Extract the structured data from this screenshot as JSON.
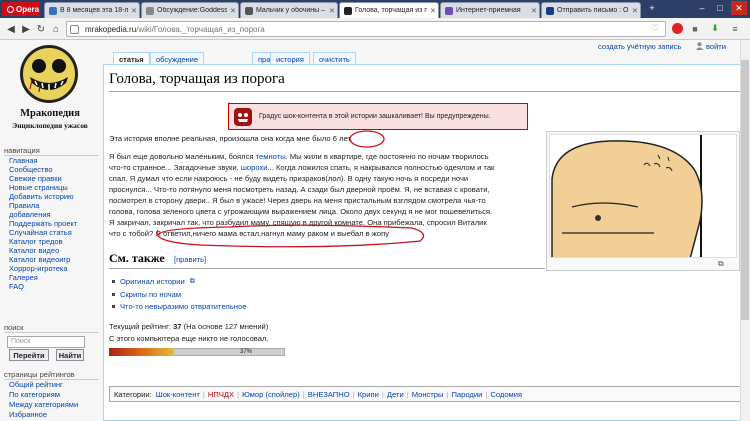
{
  "browser": {
    "opera_label": "Opera",
    "tabs": [
      {
        "label": "В 8 месяцев эта 18-летн...",
        "fav": "#3b6fbe"
      },
      {
        "label": "Обсуждение:Goddess o...",
        "fav": "#888888"
      },
      {
        "label": "Мальчик у обочины – ...",
        "fav": "#555555"
      },
      {
        "label": "Голова, торчащая из п...",
        "fav": "#222222"
      },
      {
        "label": "Интернет-приемная",
        "fav": "#6a4fb5"
      },
      {
        "label": "Отправить письмо : О...",
        "fav": "#1a3a8a"
      }
    ],
    "url_host": "mrakopedia.ru",
    "url_path": "/wiki/Голова,_торчащая_из_порога"
  },
  "personal": {
    "create_account": "создать учётную запись",
    "login": "войти"
  },
  "logo": {
    "title": "Мракопедия",
    "subtitle": "Энциклопедия ужасов"
  },
  "page_tabs": [
    "статья",
    "обсуждение",
    "править",
    "история",
    "очистить"
  ],
  "article": {
    "title": "Голова, торчащая из порога",
    "warning": "Градус шок-контента в этой истории зашкаливает! Вы предупреждены.",
    "lines": [
      [
        "Эта история вполне реальная, произошла она когда мне было 6 лет."
      ],
      [
        "Я был еще довольно маленьким, боялся ",
        "темноты",
        ". Мы жили в квартире, где постоянно по ночам творилось"
      ],
      [
        "что-то странное... Загадочные звуки, ",
        "шорохи",
        "... Когда ложился спать, я накрывался полностью одеялом и так"
      ],
      [
        "спал. Я думал что если накроюсь - не буду видеть призраков(лол). В одну такую ночь я посреди ночи"
      ],
      [
        "проснулся... Что-то потянуло меня посмотреть назад. А сзади был дверной проём. Я, не вставая с кровати,"
      ],
      [
        "посмотрел в сторону двери.. Я был в ужасе! Через дверь на меня пристальным взглядом смотрела чья-то"
      ],
      [
        "голова, голова зеленого цвета с угрожающим выражением лица. Около двух секунд я не мог пошевелиться."
      ],
      [
        "Я закричал, закричал так, что разбудил маму, спящую в другой комнате. Она прибежала, спросил Виталик"
      ],
      [
        "что с тобой? Я ответил,ничего мама встал,нагнул маму раком и выебал в жопу"
      ]
    ],
    "see_also_title": "См. также",
    "edit_link": "[править]",
    "see_also": [
      "Оригинал истории",
      "Скрипы по ночам",
      "Что-то невыразимо отвратительное"
    ],
    "rating_prefix": "Текущий рейтинг: ",
    "rating_value": "37",
    "rating_suffix": " (На основе 127 мнений)",
    "vote_status": "С этого компьютера еще никто не голосовал.",
    "rating_percent": 37,
    "rating_bar_label": "37%"
  },
  "categories": {
    "label": "Категории:",
    "items": [
      "Шок-контент",
      "НПЧДХ",
      "Юмор (спойлер)",
      "ВНЕЗАПНО",
      "Крипи",
      "Дети",
      "Монстры",
      "Пародии",
      "Содомия"
    ]
  },
  "sidebar": {
    "nav_title": "навигация",
    "nav": [
      "Главная",
      "Сообщество",
      "Свежие правки",
      "Новые страницы",
      "Добавить историю",
      "Правила",
      "добавления",
      "Поддержать проект",
      "Случайная статья",
      "Каталог тредов",
      "Каталог видео",
      "Каталог видеоигр",
      "Хоррор-игротека",
      "Галерея",
      "FAQ"
    ],
    "search_title": "поиск",
    "search_placeholder": "Поиск",
    "go_button": "Перейти",
    "find_button": "Найти",
    "ratings_title": "страницы рейтингов",
    "ratings": [
      "Общий рейтинг",
      "По категориям",
      "Между категориями",
      "Избранное"
    ]
  }
}
